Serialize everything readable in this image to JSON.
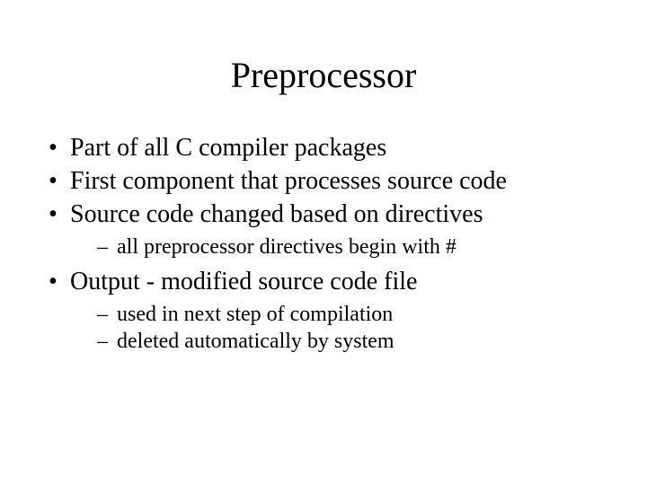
{
  "title": "Preprocessor",
  "bullets": {
    "b0": "Part of all C compiler packages",
    "b1": "First component that processes source code",
    "b2": "Source code changed based on directives",
    "b2_0": "all preprocessor directives begin with #",
    "b3": "Output - modified source code file",
    "b3_0": "used in next step of compilation",
    "b3_1": "deleted automatically by system"
  }
}
